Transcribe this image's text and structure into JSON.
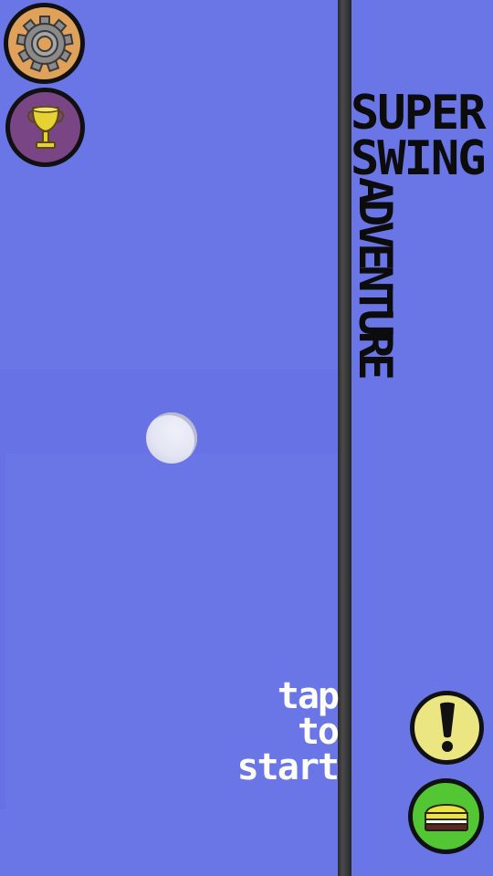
{
  "colors": {
    "background": "#6a76e6",
    "rope": "#3a3a3a",
    "settings_button": "#e0a25a",
    "trophy_button": "#7a4584",
    "alert_button": "#ece682",
    "shop_button": "#53c634",
    "ball": "#e3e5f4"
  },
  "title": {
    "line1": "SUPER",
    "line2": "SWING",
    "line3": "ADVENTURE"
  },
  "prompt": {
    "line1": "tap",
    "line2": "to",
    "line3": "start"
  },
  "icons": {
    "settings": "gear-icon",
    "leaderboard": "trophy-icon",
    "info": "exclamation-icon",
    "shop": "burger-icon"
  }
}
